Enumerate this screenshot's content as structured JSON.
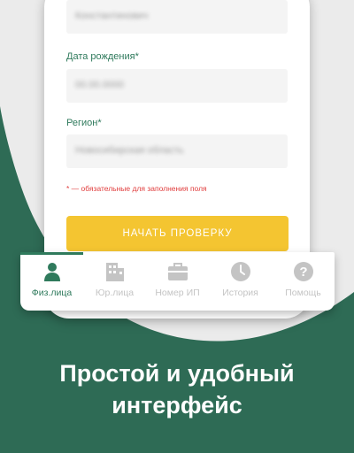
{
  "colors": {
    "background": "#2e6b55",
    "accent_green": "#2f7a5c",
    "button_yellow": "#f4c531",
    "required_red": "#e03c3c",
    "tab_inactive": "#c4c4c4"
  },
  "form": {
    "name_value": "Константинович",
    "birth_label": "Дата рождения*",
    "birth_value": "00.00.0000",
    "region_label": "Регион*",
    "region_value": "Новосибирская область",
    "required_note": "* — обязательные для заполнения поля",
    "start_button": "НАЧАТЬ ПРОВЕРКУ"
  },
  "tabs": [
    {
      "label": "Физ.лица",
      "icon": "person-icon",
      "active": true
    },
    {
      "label": "Юр.лица",
      "icon": "building-icon",
      "active": false
    },
    {
      "label": "Номер ИП",
      "icon": "briefcase-icon",
      "active": false
    },
    {
      "label": "История",
      "icon": "clock-icon",
      "active": false
    },
    {
      "label": "Помощь",
      "icon": "help-icon",
      "active": false
    }
  ],
  "promo": {
    "line1": "Простой и удобный",
    "line2": "интерфейс"
  }
}
